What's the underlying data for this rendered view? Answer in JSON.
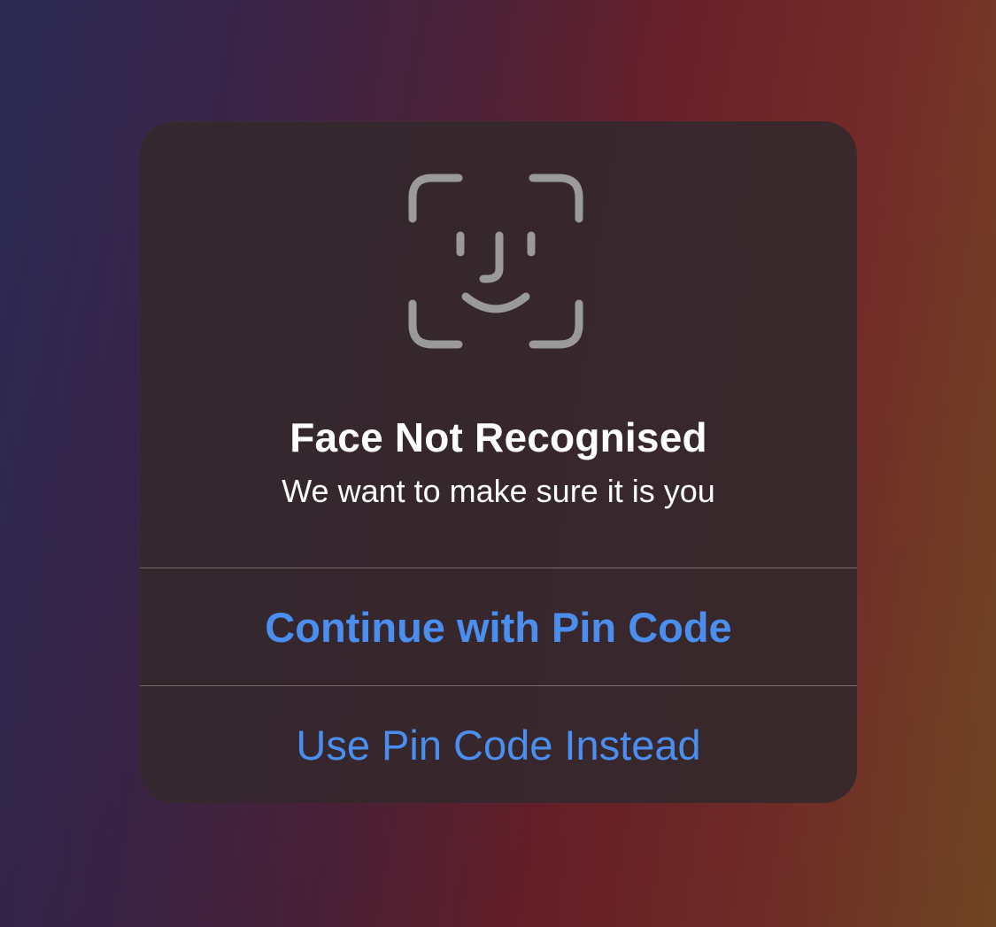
{
  "alert": {
    "icon": "face-id-icon",
    "title": "Face Not Recognised",
    "message": "We want to make sure it is you",
    "primary_button": "Continue with Pin Code",
    "secondary_button": "Use Pin Code Instead"
  },
  "colors": {
    "accent": "#4a8ff0",
    "icon": "#9a9a9a",
    "text": "#ffffff",
    "alert_background": "#34282d"
  }
}
